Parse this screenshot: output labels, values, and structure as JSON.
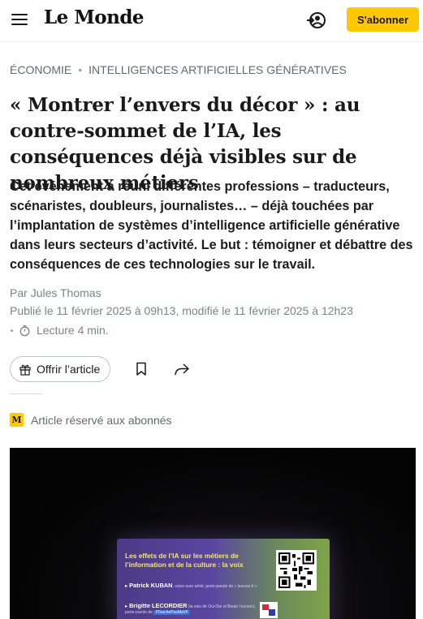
{
  "header": {
    "logo": "Le Monde",
    "subscribe_label": "S'abonner",
    "menu_icon": "hamburger-menu-icon",
    "account_icon": "account-login-icon",
    "accent_color": "#ffc800"
  },
  "breadcrumb": {
    "section": "Économie",
    "topic": "Intelligences artificielles génératives",
    "separator": "•"
  },
  "article": {
    "title": "« Montrer l’envers du décor » : au contre-sommet de l’IA, les conséquences déjà visibles sur de nombreux métiers",
    "lead": "Cet événement a réuni différentes professions – traducteurs, scénaristes, doubleurs, journalistes… – déjà touchées par l’implantation de systèmes d’intelligence artificielle générative dans leurs secteurs d’activité. Le but : témoigner et débattre des conséquences de ces technologies sur le travail.",
    "byline_prefix": "Par",
    "author": "Jules Thomas",
    "dates": "Publié le 11 février 2025 à 09h13, modifié le 11 février 2025 à 12h23",
    "reading_time": "Lecture 4 min.",
    "offer_label": "Offrir l’article",
    "premium_label": "Article réservé aux abonnés",
    "premium_badge": "M"
  },
  "photo": {
    "slide_title": "Les effets de l’IA sur les métiers de l’information et de la culture : la voix",
    "speaker1_name": "Patrick KUBAN",
    "speaker1_detail": ", voice-over artist, porte-parole de « lesvoix.fr »",
    "speaker2_name": "Brigitte LECORDIER",
    "speaker2_detail": " (la voix de Oui-Oui et Boule l’ourson),",
    "speaker2_line2_prefix": "porte-parole de ",
    "hashtag": "#TouchePasMaVF"
  }
}
